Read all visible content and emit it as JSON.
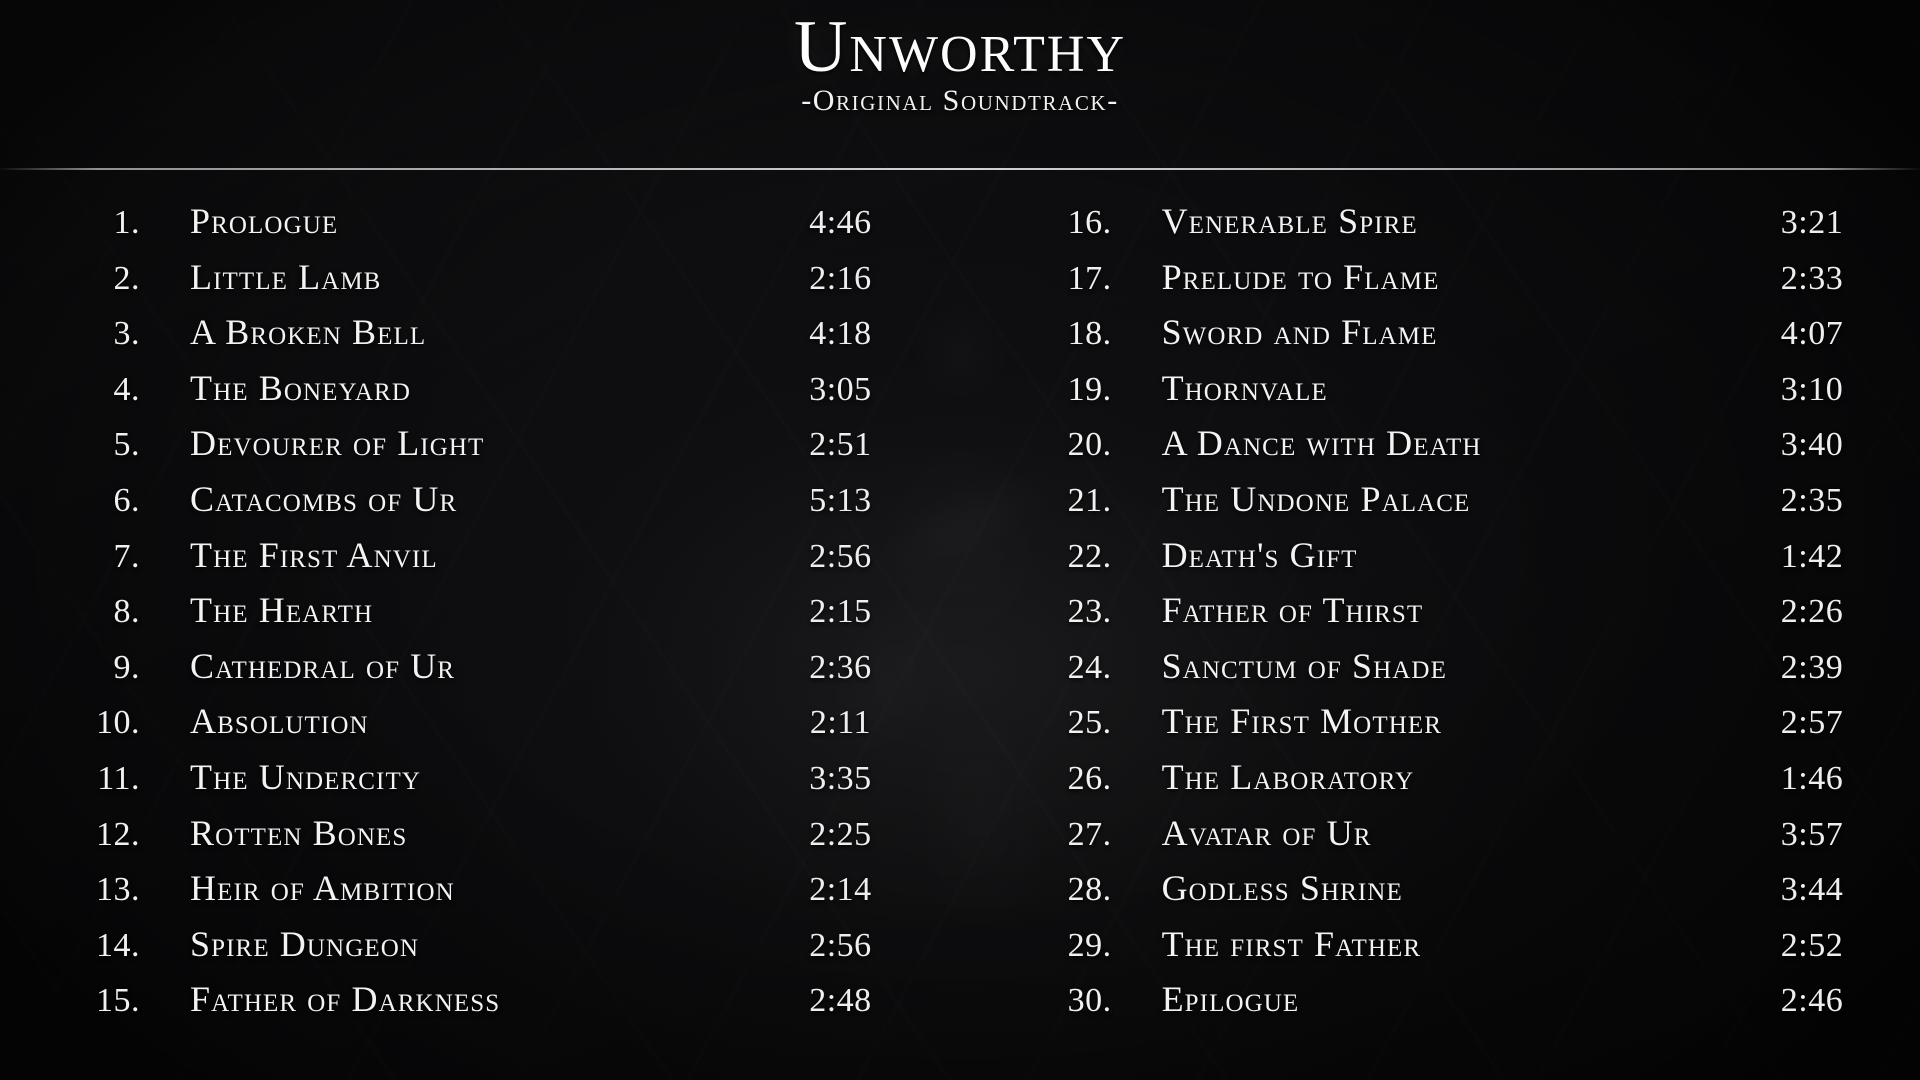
{
  "header": {
    "title": "Unworthy",
    "subtitle": "-Original Soundtrack-"
  },
  "tracklist": {
    "left_column": [
      {
        "num": "1.",
        "title": "Prologue",
        "time": "4:46"
      },
      {
        "num": "2.",
        "title": "Little Lamb",
        "time": "2:16"
      },
      {
        "num": "3.",
        "title": "A Broken Bell",
        "time": "4:18"
      },
      {
        "num": "4.",
        "title": "The Boneyard",
        "time": "3:05"
      },
      {
        "num": "5.",
        "title": "Devourer of Light",
        "time": "2:51"
      },
      {
        "num": "6.",
        "title": "Catacombs of Ur",
        "time": "5:13"
      },
      {
        "num": "7.",
        "title": "The First Anvil",
        "time": "2:56"
      },
      {
        "num": "8.",
        "title": "The Hearth",
        "time": "2:15"
      },
      {
        "num": "9.",
        "title": "Cathedral of Ur",
        "time": "2:36"
      },
      {
        "num": "10.",
        "title": "Absolution",
        "time": "2:11"
      },
      {
        "num": "11.",
        "title": "The Undercity",
        "time": "3:35"
      },
      {
        "num": "12.",
        "title": "Rotten Bones",
        "time": "2:25"
      },
      {
        "num": "13.",
        "title": "Heir of Ambition",
        "time": "2:14"
      },
      {
        "num": "14.",
        "title": "Spire Dungeon",
        "time": "2:56"
      },
      {
        "num": "15.",
        "title": "Father of Darkness",
        "time": "2:48"
      }
    ],
    "right_column": [
      {
        "num": "16.",
        "title": "Venerable Spire",
        "time": "3:21"
      },
      {
        "num": "17.",
        "title": "Prelude to Flame",
        "time": "2:33"
      },
      {
        "num": "18.",
        "title": "Sword and Flame",
        "time": "4:07"
      },
      {
        "num": "19.",
        "title": "Thornvale",
        "time": "3:10"
      },
      {
        "num": "20.",
        "title": "A Dance with Death",
        "time": "3:40"
      },
      {
        "num": "21.",
        "title": "The Undone Palace",
        "time": "2:35"
      },
      {
        "num": "22.",
        "title": "Death's Gift",
        "time": "1:42"
      },
      {
        "num": "23.",
        "title": "Father of Thirst",
        "time": "2:26"
      },
      {
        "num": "24.",
        "title": "Sanctum of Shade",
        "time": "2:39"
      },
      {
        "num": "25.",
        "title": "The First Mother",
        "time": "2:57"
      },
      {
        "num": "26.",
        "title": "The Laboratory",
        "time": "1:46"
      },
      {
        "num": "27.",
        "title": "Avatar of Ur",
        "time": "3:57"
      },
      {
        "num": "28.",
        "title": "Godless Shrine",
        "time": "3:44"
      },
      {
        "num": "29.",
        "title": "The first Father",
        "time": "2:52"
      },
      {
        "num": "30.",
        "title": "Epilogue",
        "time": "2:46"
      }
    ]
  },
  "colors": {
    "background": "#0c0c0e",
    "text": "#f3f3f3",
    "divider": "#f5f5f5"
  }
}
